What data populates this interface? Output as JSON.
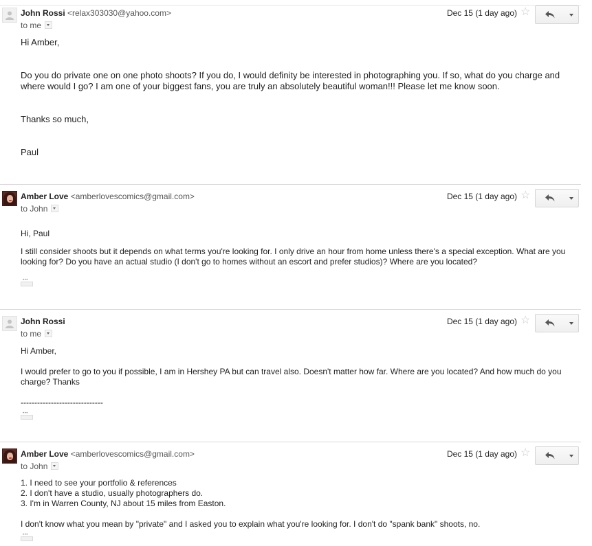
{
  "messages": [
    {
      "sender_name": "John Rossi",
      "sender_email": "<relax303030@yahoo.com>",
      "recipient": "to me",
      "date": "Dec 15 (1 day ago)",
      "avatar": "generic-person-icon",
      "body": [
        "Hi Amber,",
        "Do you do private one on one photo shoots?  If  you do, I would definity be interested in photographing you.  If so, what do you charge and where would I go?  I am one of your biggest fans, you are truly an absolutely beautiful woman!!!   Please let me know soon.",
        "Thanks so much,",
        "Paul"
      ]
    },
    {
      "sender_name": "Amber Love",
      "sender_email": "<amberlovescomics@gmail.com>",
      "recipient": "to John",
      "date": "Dec 15 (1 day ago)",
      "avatar": "profile-photo",
      "body": [
        "Hi, Paul",
        "I still consider shoots but it depends on what terms you're looking for. I only drive an hour from home unless there's a special exception. What are you looking for? Do you have an actual studio (I don't go to homes without an escort and prefer studios)? Where are you located?"
      ]
    },
    {
      "sender_name": "John Rossi",
      "sender_email": "",
      "recipient": "to me",
      "date": "Dec 15 (1 day ago)",
      "avatar": "generic-person-icon",
      "body": [
        "Hi Amber,",
        "I would prefer to go to you if possible, I am in Hershey PA but can travel also. Doesn't matter how far.  Where are you located?  And how much do you charge?  Thanks",
        "------------------------------"
      ]
    },
    {
      "sender_name": "Amber Love",
      "sender_email": "<amberlovescomics@gmail.com>",
      "recipient": "to John",
      "date": "Dec 15 (1 day ago)",
      "avatar": "profile-photo",
      "body": [
        "1. I need to see your portfolio & references",
        "2. I don't have a studio, usually photographers do.",
        "3. I'm in Warren County, NJ about 15 miles from Easton.",
        "I don't know what you mean by \"private\" and I asked you to explain what you're looking for. I don't do \"spank bank\" shoots, no."
      ]
    }
  ],
  "colors": {
    "text": "#222222",
    "meta": "#555555",
    "divider": "#d8d8d8",
    "star": "#c8c8c8"
  }
}
